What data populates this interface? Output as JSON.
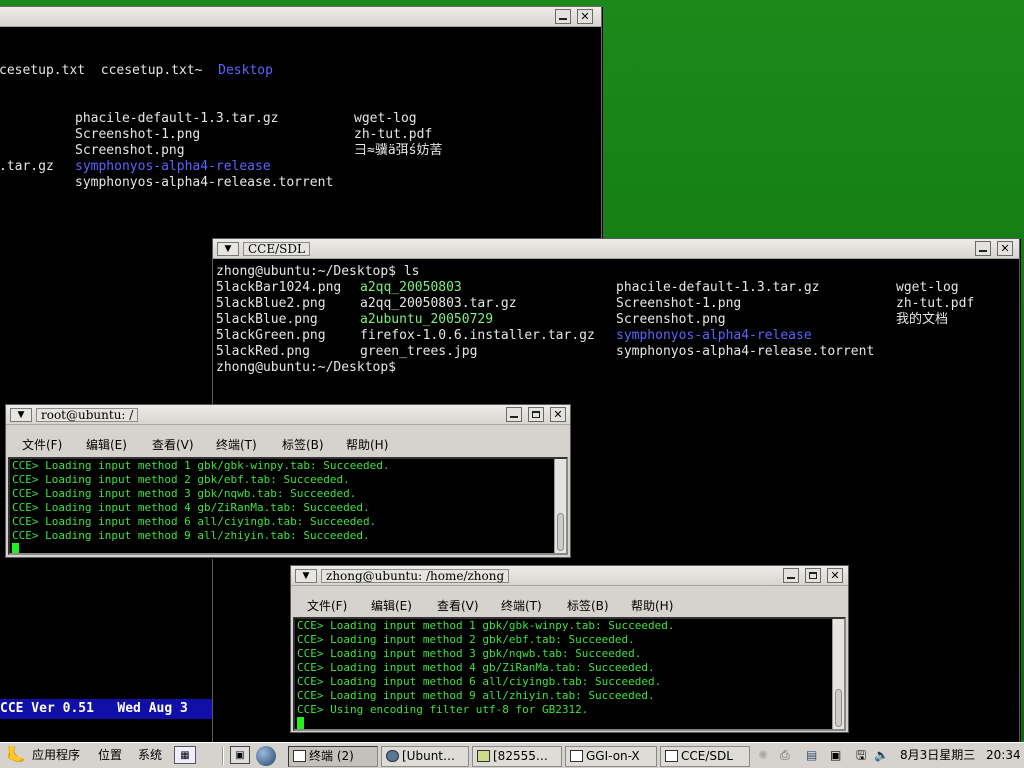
{
  "back_terminal": {
    "line1": "cesetup.txt  ccesetup.txt~  ",
    "line1_dir": "Desktop",
    "rows": [
      {
        "a": "",
        "b": "phacile-default-1.3.tar.gz",
        "c": "wget-log"
      },
      {
        "a": "",
        "b": "Screenshot-1.png",
        "c": "zh-tut.pdf"
      },
      {
        "a": "",
        "b": "Screenshot.png",
        "c": "彐≈骥ä弭ś妨䒷"
      },
      {
        "a": ".tar.gz",
        "b": "symphonyos-alpha4-release",
        "c": ""
      },
      {
        "a": "",
        "b": "symphonyos-alpha4-release.torrent",
        "c": ""
      }
    ]
  },
  "cce_status": "CCE Ver 0.51   Wed Aug 3",
  "cce_window": {
    "title": "CCE/SDL",
    "prompt": "zhong@ubuntu:~/Desktop$ ls",
    "prompt_end": "zhong@ubuntu:~/Desktop$",
    "col1": [
      "5lackBar1024.png",
      "5lackBlue2.png",
      "5lackBlue.png",
      "5lackGreen.png",
      "5lackRed.png"
    ],
    "col2": [
      "a2qq_20050803",
      "a2qq_20050803.tar.gz",
      "a2ubuntu_20050729",
      "firefox-1.0.6.installer.tar.gz",
      "green_trees.jpg"
    ],
    "col3": [
      "phacile-default-1.3.tar.gz",
      "Screenshot-1.png",
      "Screenshot.png",
      "symphonyos-alpha4-release",
      "symphonyos-alpha4-release.torrent"
    ],
    "col4": [
      "wget-log",
      "zh-tut.pdf",
      "我的文档",
      "",
      ""
    ],
    "colors": {
      "dir": "#7cf07c",
      "link": "#5b63ff",
      "file": "#e6e6e6"
    }
  },
  "root_term": {
    "title": "root@ubuntu: /",
    "menu": [
      "文件(F)",
      "编辑(E)",
      "查看(V)",
      "终端(T)",
      "标签(B)",
      "帮助(H)"
    ],
    "lines": [
      "CCE> Loading input method 1 gbk/gbk-winpy.tab: Succeeded.",
      "CCE> Loading input method 2 gbk/ebf.tab: Succeeded.",
      "CCE> Loading input method 3 gbk/nqwb.tab: Succeeded.",
      "CCE> Loading input method 4 gb/ZiRanMa.tab: Succeeded.",
      "CCE> Loading input method 6 all/ciyingb.tab: Succeeded.",
      "CCE> Loading input method 9 all/zhiyin.tab: Succeeded."
    ]
  },
  "zhong_term": {
    "title": "zhong@ubuntu: /home/zhong",
    "menu": [
      "文件(F)",
      "编辑(E)",
      "查看(V)",
      "终端(T)",
      "标签(B)",
      "帮助(H)"
    ],
    "lines": [
      "CCE> Loading input method 1 gbk/gbk-winpy.tab: Succeeded.",
      "CCE> Loading input method 2 gbk/ebf.tab: Succeeded.",
      "CCE> Loading input method 3 gbk/nqwb.tab: Succeeded.",
      "CCE> Loading input method 4 gb/ZiRanMa.tab: Succeeded.",
      "CCE> Loading input method 6 all/ciyingb.tab: Succeeded.",
      "CCE> Loading input method 9 all/zhiyin.tab: Succeeded.",
      "CCE> Using encoding filter utf-8 for GB2312."
    ]
  },
  "taskbar": {
    "apps": "应用程序",
    "places": "位置",
    "system": "系统",
    "tasks": [
      "终端 (2)",
      "[Ubunt…",
      "[82555…",
      "GGI-on-X",
      "CCE/SDL"
    ],
    "date": "8月3日星期三",
    "time": "20:34"
  }
}
